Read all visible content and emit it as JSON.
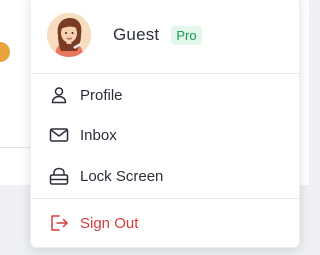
{
  "user": {
    "name": "Guest",
    "badge": "Pro",
    "avatar_icon": "user-avatar-illustration"
  },
  "menu": {
    "items": [
      {
        "label": "Profile",
        "icon": "user-icon"
      },
      {
        "label": "Inbox",
        "icon": "mail-icon"
      },
      {
        "label": "Lock Screen",
        "icon": "lock-icon"
      }
    ],
    "sign_out": {
      "label": "Sign Out",
      "icon": "sign-out-icon"
    }
  },
  "colors": {
    "badge_text": "#1a9a55",
    "badge_bg": "#e2f6ea",
    "danger": "#d63b3b"
  }
}
